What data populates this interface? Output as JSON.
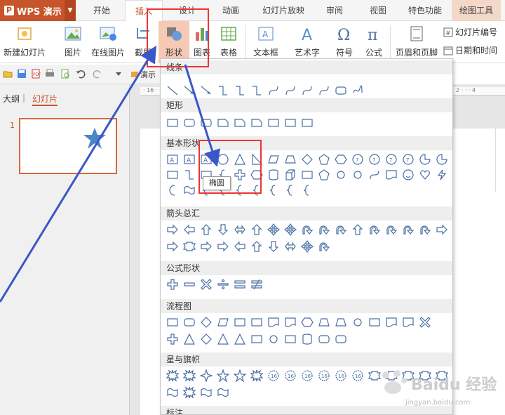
{
  "app": {
    "name": "WPS 演示",
    "logo_letter": "P"
  },
  "tabs": [
    {
      "label": "开始"
    },
    {
      "label": "插入",
      "active": true
    },
    {
      "label": "设计"
    },
    {
      "label": "动画"
    },
    {
      "label": "幻灯片放映"
    },
    {
      "label": "审阅"
    },
    {
      "label": "视图"
    },
    {
      "label": "特色功能"
    },
    {
      "label": "绘图工具"
    }
  ],
  "ribbon": {
    "new_slide": "新建幻灯片",
    "picture": "图片",
    "online_picture": "在线图片",
    "screenshot": "截屏",
    "shape": "形状",
    "chart": "图表",
    "table": "表格",
    "textbox": "文本框",
    "art_text": "艺术字",
    "symbol": "符号",
    "formula": "公式",
    "header_footer": "页眉和页脚",
    "slide_number": "幻灯片编号",
    "date_time": "日期和时间",
    "demo_label": "演示"
  },
  "left_panel": {
    "outline_tab": "大纲",
    "slides_tab": "幻灯片",
    "slide_number": "1"
  },
  "ruler_text": "· 16 · · · 14",
  "ruler_right_text": "2 · · · 4",
  "shape_menu": {
    "sections": {
      "lines": "线条",
      "rectangles": "矩形",
      "basic": "基本形状",
      "arrows": "箭头总汇",
      "equation": "公式形状",
      "flowchart": "流程图",
      "stars": "星与旗帜",
      "callouts": "标注"
    },
    "tooltip": "椭圆"
  },
  "colors": {
    "accent": "#c7542a",
    "highlight_box": "#e33333",
    "annotation_arrow": "#3a57c8",
    "shape_stroke": "#4a6fa5"
  },
  "watermark": {
    "text": "Baidu 经验",
    "sub": "jingyan.baidu.com"
  }
}
